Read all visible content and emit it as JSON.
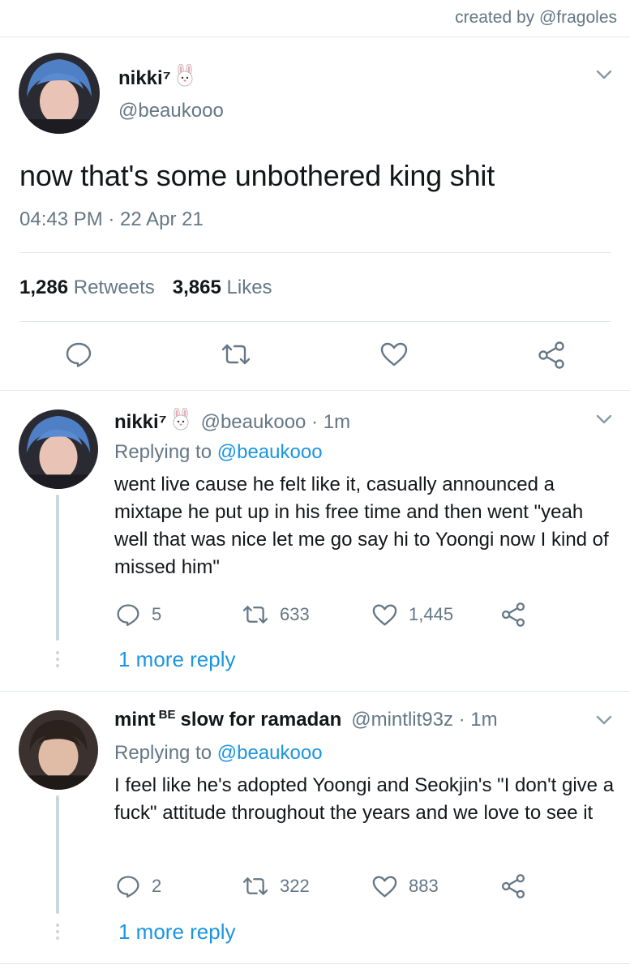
{
  "credit": "created by @fragoles",
  "main_tweet": {
    "display_name": "nikki⁷",
    "emoji": "rabbit-face-emoji",
    "handle": "@beaukooo",
    "text": "now that's some unbothered king shit",
    "timestamp": "04:43 PM · 22 Apr 21",
    "retweets_count": "1,286",
    "retweets_label": "Retweets",
    "likes_count": "3,865",
    "likes_label": "Likes"
  },
  "replies": [
    {
      "display_name": "nikki⁷",
      "emoji": "rabbit-face-emoji",
      "handle_time": "@beaukooo · 1m",
      "replying_prefix": "Replying to ",
      "replying_to": "@beaukooo",
      "text": "went live cause he felt like it, casually announced a mixtape he put up in his free time and then went \"yeah well that was nice let me go say hi to Yoongi now I kind of missed him\"",
      "replies": "5",
      "retweets": "633",
      "likes": "1,445",
      "more_replies": "1 more reply"
    },
    {
      "display_name_a": "mint",
      "display_name_sup": "BE",
      "display_name_b": "slow for ramadan",
      "handle_time": "@mintlit93z · 1m",
      "replying_prefix": "Replying to ",
      "replying_to": "@beaukooo",
      "text": "I feel like he's adopted Yoongi and Seokjin's \"I don't give a fuck\" attitude throughout the years and we love to see it",
      "replies": "2",
      "retweets": "322",
      "likes": "883",
      "more_replies": "1 more reply"
    }
  ],
  "colors": {
    "link": "#1b95e0",
    "muted": "#657786",
    "divider": "#e1e8ed",
    "thread_line": "#ccd6dd"
  }
}
